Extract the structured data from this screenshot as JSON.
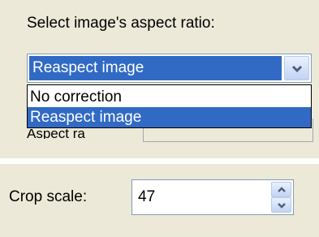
{
  "aspect": {
    "heading": "Select image's aspect ratio:",
    "selected": "Reaspect image",
    "options": [
      "No correction",
      "Reaspect image"
    ],
    "highlighted_index": 1,
    "partially_hidden_label": "Aspect ra"
  },
  "crop": {
    "label": "Crop scale:",
    "value": "47"
  },
  "icons": {
    "dropdown": "chevron-down-icon",
    "spin_up": "arrow-up-icon",
    "spin_down": "arrow-down-icon"
  },
  "colors": {
    "panel_bg": "#ece9d8",
    "selection": "#316ac5",
    "field_border": "#7f9db9"
  }
}
